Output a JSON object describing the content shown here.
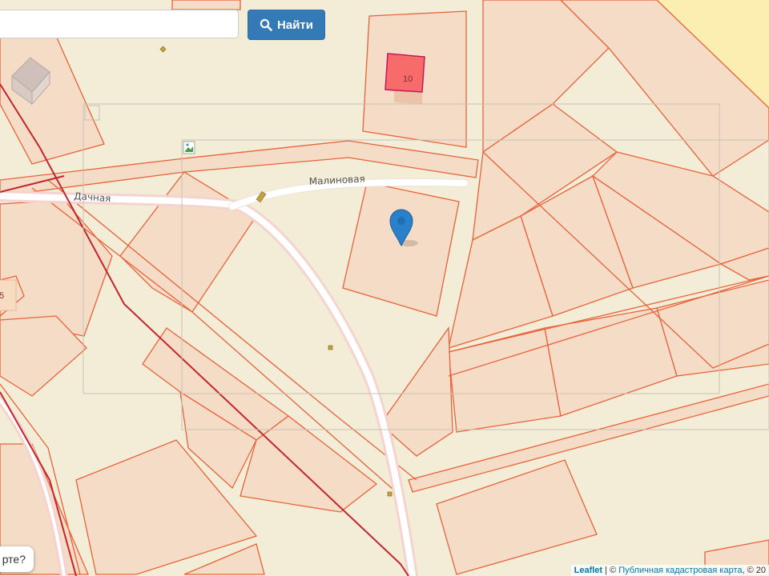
{
  "search": {
    "placeholder": "",
    "value": "",
    "button_label": "Найти"
  },
  "map": {
    "streets": [
      {
        "name": "Дачная"
      },
      {
        "name": "Малиновая"
      }
    ],
    "parcel_labels": [
      "10",
      "5"
    ],
    "marker_icon": "map-pin-icon",
    "colors": {
      "background": "#f3ecd6",
      "parcel_fill": "#f5dcc6",
      "parcel_stroke": "#e8623a",
      "highlight_fill": "#f86b6b",
      "power_line": "#c1272d",
      "marker": "#2a81cb"
    }
  },
  "help": {
    "text": "рте?"
  },
  "attribution": {
    "leaflet": "Leaflet",
    "separator": " | © ",
    "source": "Публичная кадастровая карта",
    "suffix": ", © 20"
  }
}
